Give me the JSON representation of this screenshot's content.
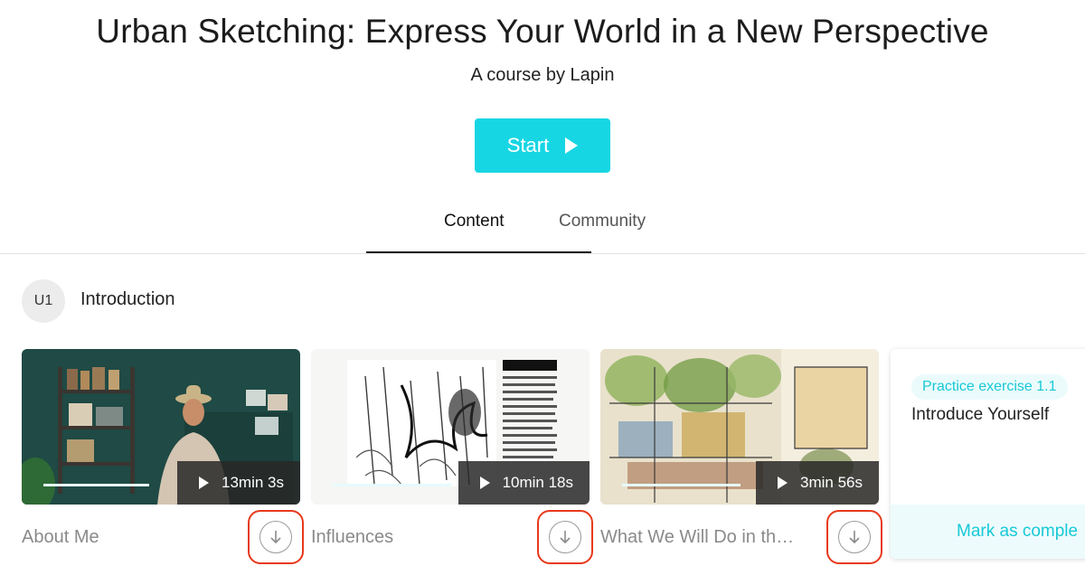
{
  "course": {
    "title": "Urban Sketching: Express Your World in a New Perspective",
    "subtitle": "A course by Lapin",
    "start_label": "Start"
  },
  "tabs": [
    {
      "label": "Content",
      "active": true
    },
    {
      "label": "Community",
      "active": false
    }
  ],
  "unit": {
    "badge": "U1",
    "title": "Introduction"
  },
  "videos": [
    {
      "title": "About Me",
      "duration": "13min 3s",
      "progress": 0.39
    },
    {
      "title": "Influences",
      "duration": "10min 18s",
      "progress": 0.43
    },
    {
      "title": "What We Will Do in the …",
      "duration": "3min 56s",
      "progress": 0.43
    }
  ],
  "exercise": {
    "badge": "Practice exercise 1.1",
    "title": "Introduce Yourself",
    "action": "Mark as comple"
  },
  "colors": {
    "accent": "#17d6e3",
    "highlight": "#e8391c"
  },
  "icons": [
    "play-icon",
    "download-icon"
  ]
}
